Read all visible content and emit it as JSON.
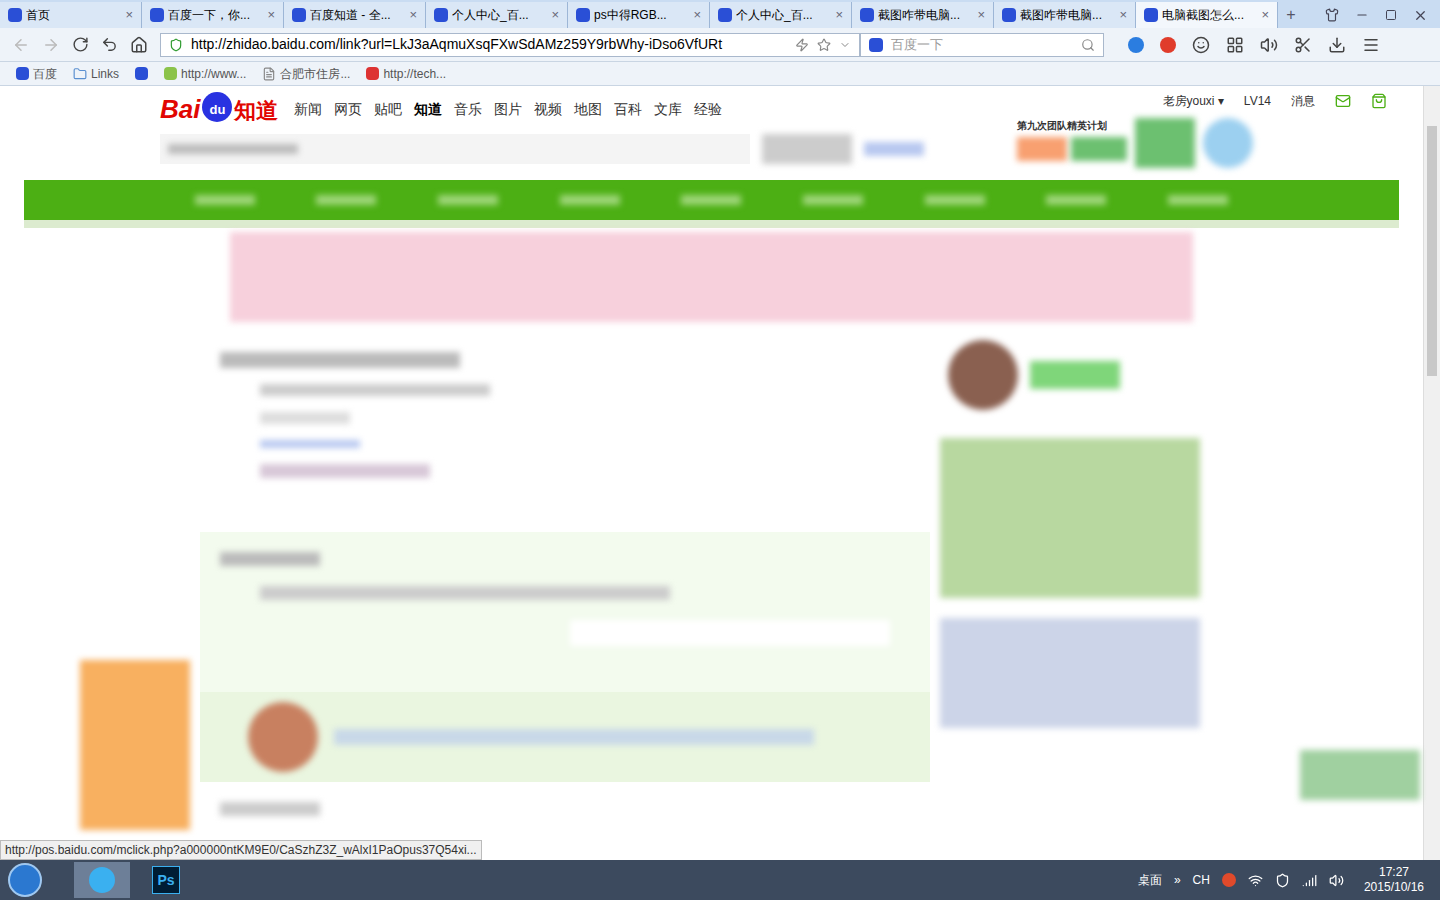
{
  "tabs": [
    {
      "label": "首页",
      "selected": false
    },
    {
      "label": "百度一下，你...",
      "selected": false
    },
    {
      "label": "百度知道 - 全...",
      "selected": false
    },
    {
      "label": "个人中心_百...",
      "selected": false
    },
    {
      "label": "ps中得RGB...",
      "selected": false
    },
    {
      "label": "个人中心_百...",
      "selected": false
    },
    {
      "label": "截图咋带电脑...",
      "selected": false
    },
    {
      "label": "截图咋带电脑...",
      "selected": false
    },
    {
      "label": "电脑截图怎么...",
      "selected": true
    }
  ],
  "tab_close": "×",
  "new_tab": "+",
  "address": "http://zhidao.baidu.com/link?url=LkJ3aAqmuXsqFXwSdAMz259Y9rbWhy-iDso6VfURt",
  "search": {
    "placeholder": "百度一下"
  },
  "bookmarks": [
    "百度",
    "Links",
    "",
    "http://www...",
    "合肥市住房...",
    "http://tech..."
  ],
  "logo": {
    "bai": "Bai",
    "du": "du",
    "zhidao": "知道"
  },
  "nav": [
    {
      "label": "新闻",
      "selected": false
    },
    {
      "label": "网页",
      "selected": false
    },
    {
      "label": "贴吧",
      "selected": false
    },
    {
      "label": "知道",
      "selected": true
    },
    {
      "label": "音乐",
      "selected": false
    },
    {
      "label": "图片",
      "selected": false
    },
    {
      "label": "视频",
      "selected": false
    },
    {
      "label": "地图",
      "selected": false
    },
    {
      "label": "百科",
      "selected": false
    },
    {
      "label": "文库",
      "selected": false
    },
    {
      "label": "经验",
      "selected": false
    }
  ],
  "user": {
    "name": "老房youxi",
    "caret": "▾",
    "level": "LV14",
    "messages": "消息"
  },
  "promo": "第九次团队精英计划",
  "status_url": "http://pos.baidu.com/mclick.php?a000000ntKM9E0/CaSzhZ3Z_wAlxI1PaOpus37Q54xi...",
  "taskbar": {
    "ps": "Ps",
    "desktop": "桌面",
    "more": "»",
    "lang": "CH",
    "time": "17:27",
    "date": "2015/10/16"
  }
}
